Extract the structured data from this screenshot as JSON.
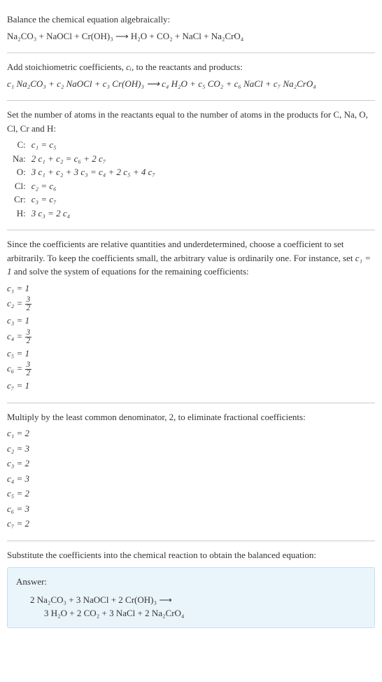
{
  "section1": {
    "title": "Balance the chemical equation algebraically:",
    "equation": "Na₂CO₃ + NaOCl + Cr(OH)₃ ⟶ H₂O + CO₂ + NaCl + Na₂CrO₄"
  },
  "section2": {
    "title_pre": "Add stoichiometric coefficients, ",
    "title_var": "cᵢ",
    "title_post": ", to the reactants and products:",
    "equation": "c₁ Na₂CO₃ + c₂ NaOCl + c₃ Cr(OH)₃ ⟶ c₄ H₂O + c₅ CO₂ + c₆ NaCl + c₇ Na₂CrO₄"
  },
  "section3": {
    "title": "Set the number of atoms in the reactants equal to the number of atoms in the products for C, Na, O, Cl, Cr and H:",
    "rows": [
      {
        "label": "C:",
        "eq": "c₁ = c₅"
      },
      {
        "label": "Na:",
        "eq": "2 c₁ + c₂ = c₆ + 2 c₇"
      },
      {
        "label": "O:",
        "eq": "3 c₁ + c₂ + 3 c₃ = c₄ + 2 c₅ + 4 c₇"
      },
      {
        "label": "Cl:",
        "eq": "c₂ = c₆"
      },
      {
        "label": "Cr:",
        "eq": "c₃ = c₇"
      },
      {
        "label": "H:",
        "eq": "3 c₃ = 2 c₄"
      }
    ]
  },
  "section4": {
    "title_pre": "Since the coefficients are relative quantities and underdetermined, choose a coefficient to set arbitrarily. To keep the coefficients small, the arbitrary value is ordinarily one. For instance, set ",
    "title_var": "c₁ = 1",
    "title_post": " and solve the system of equations for the remaining coefficients:",
    "coeffs": [
      {
        "lhs": "c₁ = ",
        "val": "1",
        "frac": false
      },
      {
        "lhs": "c₂ = ",
        "num": "3",
        "den": "2",
        "frac": true
      },
      {
        "lhs": "c₃ = ",
        "val": "1",
        "frac": false
      },
      {
        "lhs": "c₄ = ",
        "num": "3",
        "den": "2",
        "frac": true
      },
      {
        "lhs": "c₅ = ",
        "val": "1",
        "frac": false
      },
      {
        "lhs": "c₆ = ",
        "num": "3",
        "den": "2",
        "frac": true
      },
      {
        "lhs": "c₇ = ",
        "val": "1",
        "frac": false
      }
    ]
  },
  "section5": {
    "title": "Multiply by the least common denominator, 2, to eliminate fractional coefficients:",
    "coeffs": [
      "c₁ = 2",
      "c₂ = 3",
      "c₃ = 2",
      "c₄ = 3",
      "c₅ = 2",
      "c₆ = 3",
      "c₇ = 2"
    ]
  },
  "section6": {
    "title": "Substitute the coefficients into the chemical reaction to obtain the balanced equation:",
    "answer_label": "Answer:",
    "answer_line1": "2 Na₂CO₃ + 3 NaOCl + 2 Cr(OH)₃ ⟶",
    "answer_line2": "3 H₂O + 2 CO₂ + 3 NaCl + 2 Na₂CrO₄"
  }
}
